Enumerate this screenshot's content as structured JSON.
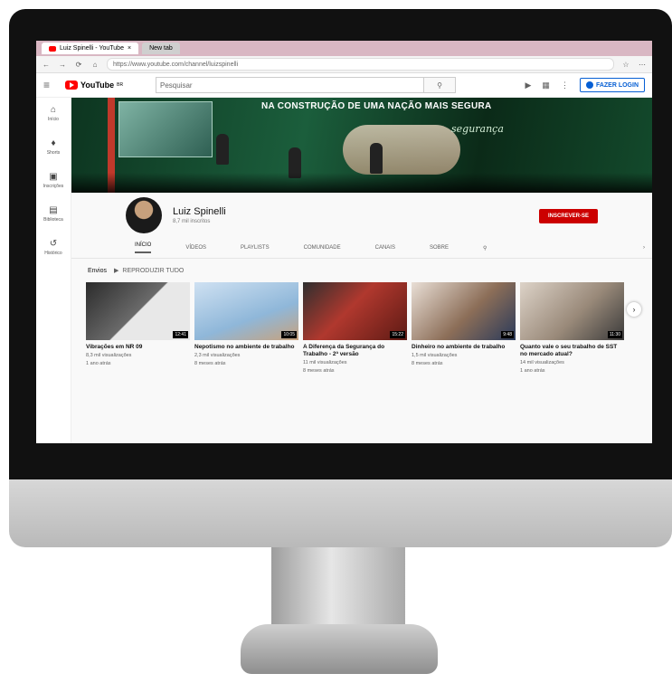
{
  "browser": {
    "tabs": [
      {
        "label": "Luiz Spinelli - YouTube"
      },
      {
        "label": "New tab"
      }
    ],
    "url": "https://www.youtube.com/channel/luizspinelli"
  },
  "youtube": {
    "logo_text": "YouTube",
    "logo_sup": "BR",
    "search_placeholder": "Pesquisar",
    "signin_label": "FAZER LOGIN"
  },
  "sidebar": {
    "items": [
      {
        "label": "Início",
        "icon": "home-icon"
      },
      {
        "label": "Shorts",
        "icon": "shorts-icon"
      },
      {
        "label": "Inscrições",
        "icon": "subscriptions-icon"
      },
      {
        "label": "Biblioteca",
        "icon": "library-icon"
      },
      {
        "label": "Histórico",
        "icon": "history-icon"
      }
    ]
  },
  "banner": {
    "slogan": "NA CONSTRUÇÃO DE UMA NAÇÃO MAIS SEGURA",
    "script_text": "segurança"
  },
  "channel": {
    "name": "Luiz Spinelli",
    "subscribers": "8,7 mil inscritos",
    "subscribe_label": "INSCREVER-SE"
  },
  "tabs": [
    "INÍCIO",
    "VÍDEOS",
    "PLAYLISTS",
    "COMUNIDADE",
    "CANAIS",
    "SOBRE"
  ],
  "section": {
    "title": "Envios",
    "play_all": "REPRODUZIR TUDO"
  },
  "videos": [
    {
      "title": "Vibrações em NR 09",
      "views": "8,3 mil visualizações",
      "age": "1 ano atrás",
      "duration": "12:41",
      "thumb_color": "#3a3a3a"
    },
    {
      "title": "Nepotismo no ambiente de trabalho",
      "views": "2,3 mil visualizações",
      "age": "8 meses atrás",
      "duration": "10:05",
      "thumb_color": "#8fb7d9"
    },
    {
      "title": "A Diferença da Segurança do Trabalho - 2ª versão",
      "views": "11 mil visualizações",
      "age": "8 meses atrás",
      "duration": "15:22",
      "thumb_color": "#b0382e"
    },
    {
      "title": "Dinheiro no ambiente de trabalho",
      "views": "1,5 mil visualizações",
      "age": "8 meses atrás",
      "duration": "9:48",
      "thumb_color": "#8c6e58"
    },
    {
      "title": "Quanto vale o seu trabalho de SST no mercado atual?",
      "views": "14 mil visualizações",
      "age": "1 ano atrás",
      "duration": "11:30",
      "thumb_color": "#9a8a7a"
    }
  ]
}
